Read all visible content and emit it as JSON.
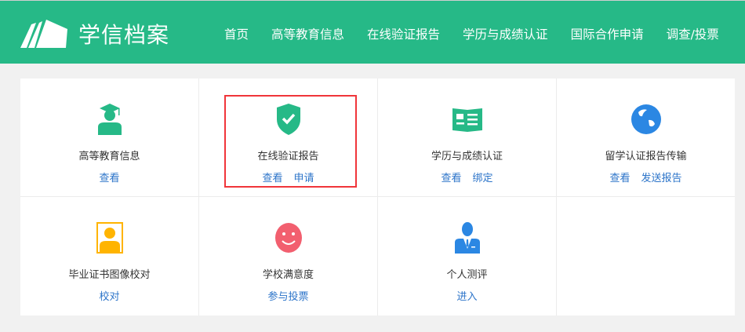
{
  "header": {
    "brand": "学信档案",
    "nav": [
      "首页",
      "高等教育信息",
      "在线验证报告",
      "学历与成绩认证",
      "国际合作申请",
      "调查/投票"
    ]
  },
  "colors": {
    "brand": "#26b987",
    "link": "#2c74c9",
    "highlight": "#f0353a"
  },
  "services": [
    {
      "title": "高等教育信息",
      "icon": "graduate-icon",
      "links": [
        "查看"
      ]
    },
    {
      "title": "在线验证报告",
      "icon": "shield-check-icon",
      "links": [
        "查看",
        "申请"
      ]
    },
    {
      "title": "学历与成绩认证",
      "icon": "book-icon",
      "links": [
        "查看",
        "绑定"
      ]
    },
    {
      "title": "留学认证报告传输",
      "icon": "globe-icon",
      "links": [
        "查看",
        "发送报告"
      ]
    },
    {
      "title": "毕业证书图像校对",
      "icon": "photo-id-icon",
      "links": [
        "校对"
      ]
    },
    {
      "title": "学校满意度",
      "icon": "smile-icon",
      "links": [
        "参与投票"
      ]
    },
    {
      "title": "个人测评",
      "icon": "person-suit-icon",
      "links": [
        "进入"
      ]
    }
  ]
}
